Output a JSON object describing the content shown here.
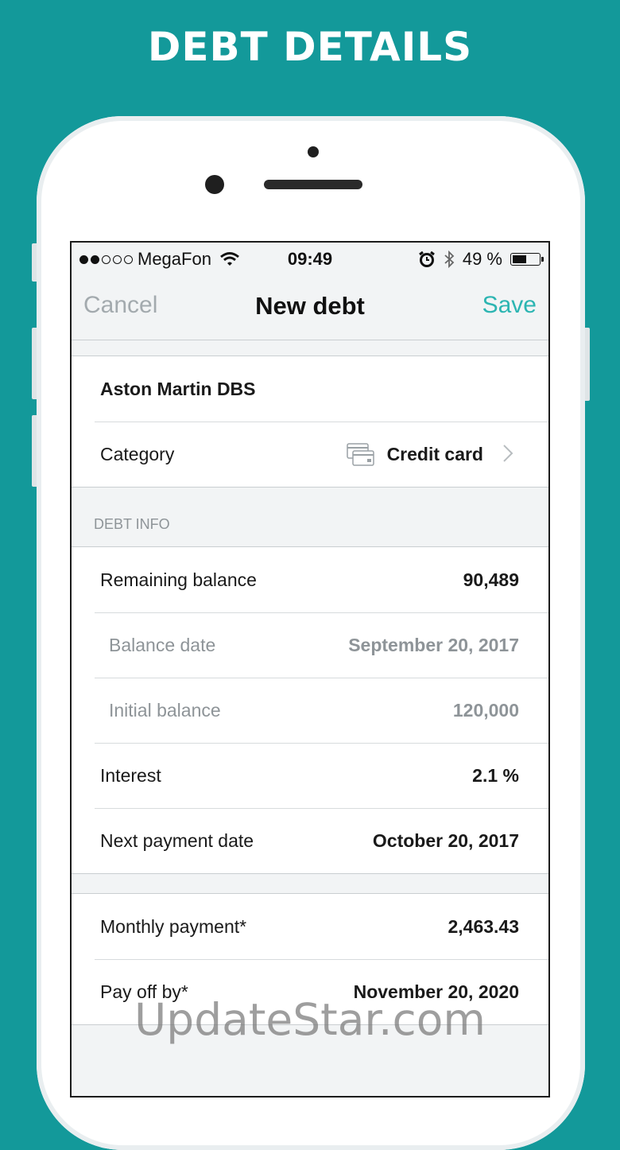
{
  "banner": {
    "title": "DEBT DETAILS"
  },
  "status_bar": {
    "carrier": "MegaFon",
    "time": "09:49",
    "battery": "49 %",
    "battery_level": 0.49,
    "signal_bars_filled": 2,
    "signal_bars_total": 5
  },
  "nav": {
    "cancel": "Cancel",
    "title": "New debt",
    "save": "Save"
  },
  "debt": {
    "name": "Aston Martin DBS",
    "category_label": "Category",
    "category_value": "Credit card"
  },
  "debt_info": {
    "header": "DEBT INFO",
    "rows": [
      {
        "label": "Remaining balance",
        "value": "90,489"
      },
      {
        "label": "Balance date",
        "value": "September 20, 2017"
      },
      {
        "label": "Initial balance",
        "value": "120,000"
      },
      {
        "label": "Interest",
        "value": "2.1 %"
      },
      {
        "label": "Next payment date",
        "value": "October 20, 2017"
      }
    ]
  },
  "schedule": {
    "rows": [
      {
        "label": "Monthly payment*",
        "value": "2,463.43"
      },
      {
        "label": "Pay off by*",
        "value": "November 20, 2020"
      }
    ]
  },
  "watermark": "UpdateStar.com",
  "colors": {
    "background": "#13999a",
    "accent": "#2cb5b2",
    "muted": "#8e9498"
  }
}
